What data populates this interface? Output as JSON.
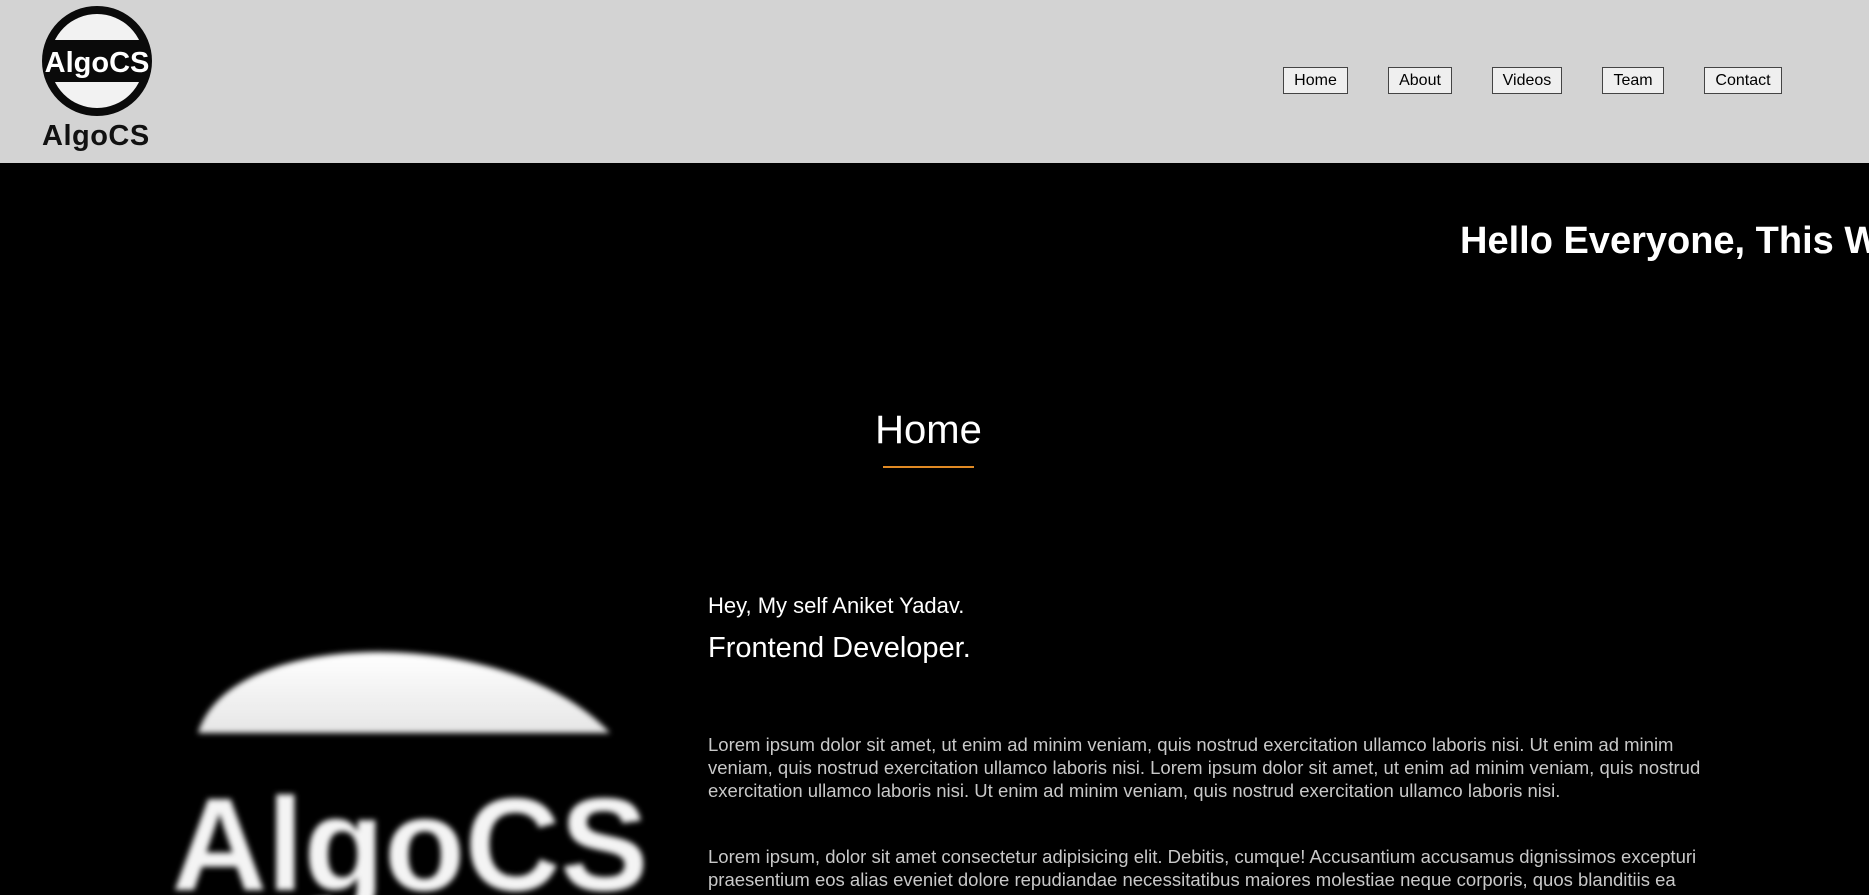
{
  "header": {
    "logo_badge_text": "AlgoCS",
    "logo_text": "AlgoCS",
    "nav": {
      "home": "Home",
      "about": "About",
      "videos": "Videos",
      "team": "Team",
      "contact": "Contact"
    }
  },
  "marquee": {
    "text": "Hello Everyone, This W"
  },
  "home": {
    "title": "Home",
    "logo_text": "AlgoCS",
    "greeting": "Hey, My self Aniket Yadav.",
    "role": "Frontend Developer.",
    "paragraph_1": "Lorem ipsum dolor sit amet, ut enim ad minim veniam, quis nostrud exercitation ullamco laboris nisi. Ut enim ad minim veniam, quis nostrud exercitation ullamco laboris nisi. Lorem ipsum dolor sit amet, ut enim ad minim veniam, quis nostrud exercitation ullamco laboris nisi. Ut enim ad minim veniam, quis nostrud exercitation ullamco laboris nisi.",
    "paragraph_2": "Lorem ipsum, dolor sit amet consectetur adipisicing elit. Debitis, cumque! Accusantium accusamus dignissimos excepturi praesentium eos alias eveniet dolore repudiandae necessitatibus maiores molestiae neque corporis, quos blanditiis ea dolorem nemo vero sit."
  },
  "colors": {
    "header_bg": "#d3d3d3",
    "page_bg": "#000000",
    "accent_underline": "#e08a24",
    "body_text": "#c8c8c8"
  }
}
